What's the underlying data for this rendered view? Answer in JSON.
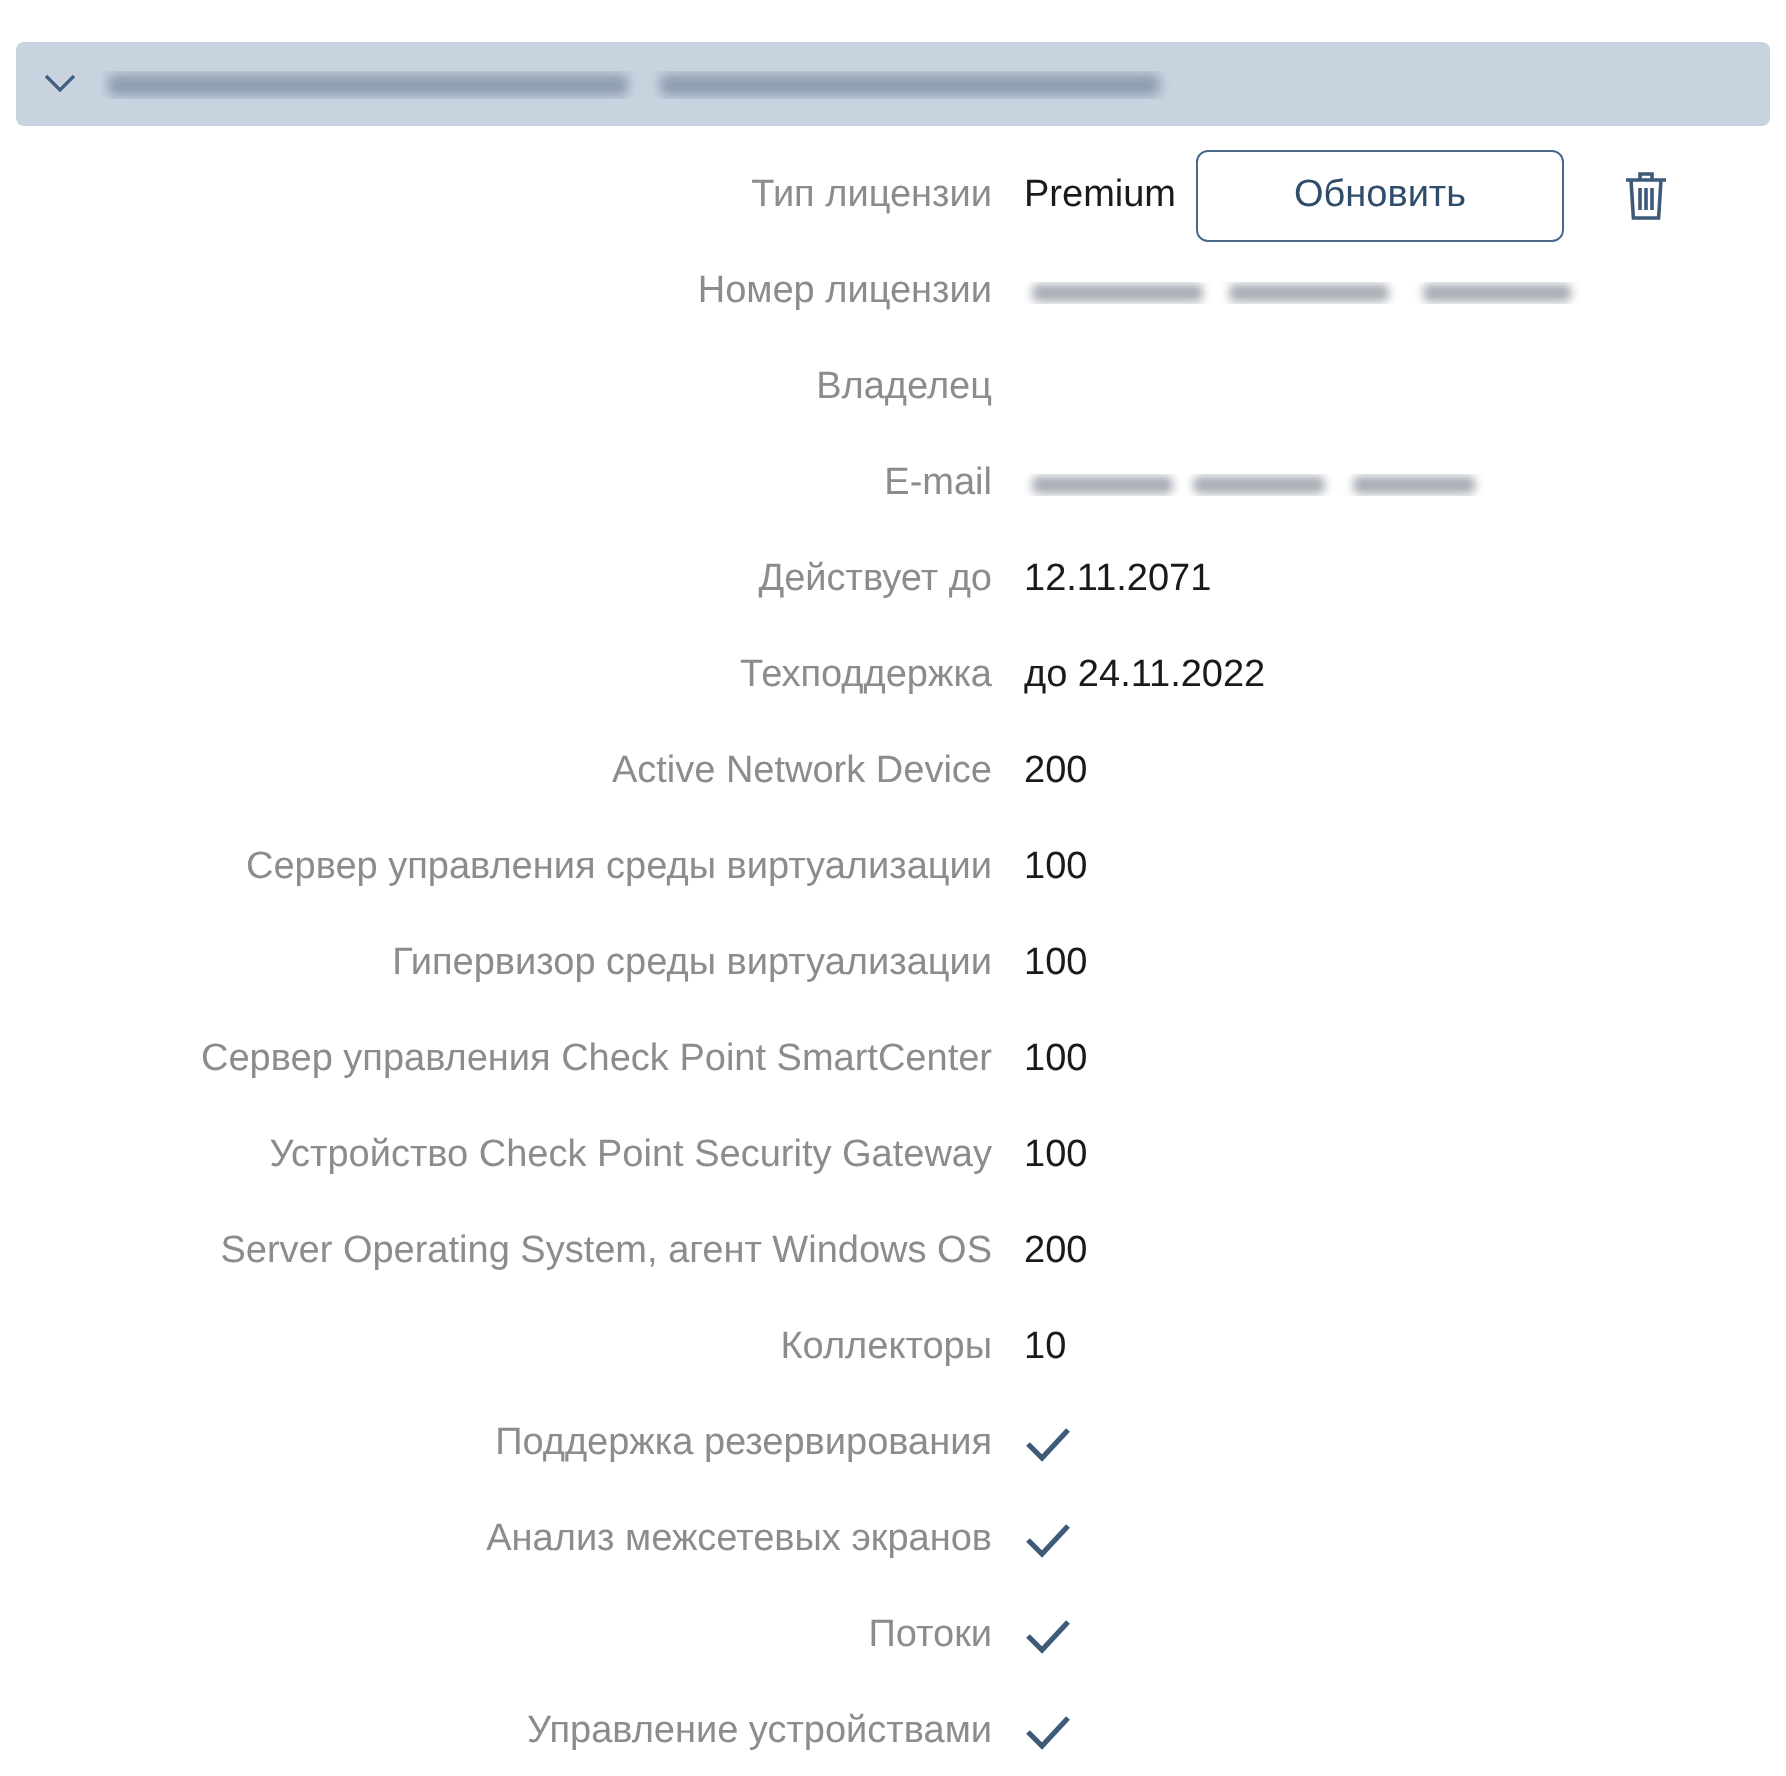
{
  "header": {
    "expanded": true,
    "title_redacted": true
  },
  "update_button": "Обновить",
  "rows": [
    {
      "label": "Тип лицензии",
      "kind": "text",
      "value": "Premium"
    },
    {
      "label": "Номер лицензии",
      "kind": "redacted"
    },
    {
      "label": "Владелец",
      "kind": "empty"
    },
    {
      "label": "E-mail",
      "kind": "redacted"
    },
    {
      "label": "Действует до",
      "kind": "text",
      "value": "12.11.2071"
    },
    {
      "label": "Техподдержка",
      "kind": "text",
      "value": "до 24.11.2022"
    },
    {
      "label": "Active Network Device",
      "kind": "text",
      "value": "200"
    },
    {
      "label": "Сервер управления среды виртуализации",
      "kind": "text",
      "value": "100"
    },
    {
      "label": "Гипервизор среды виртуализации",
      "kind": "text",
      "value": "100"
    },
    {
      "label": "Сервер управления Check Point SmartCenter",
      "kind": "text",
      "value": "100"
    },
    {
      "label": "Устройство Check Point Security Gateway",
      "kind": "text",
      "value": "100"
    },
    {
      "label": "Server Operating System, агент Windows OS",
      "kind": "text",
      "value": "200"
    },
    {
      "label": "Коллекторы",
      "kind": "text",
      "value": "10"
    },
    {
      "label": "Поддержка резервирования",
      "kind": "check",
      "checked": true
    },
    {
      "label": "Анализ межсетевых экранов",
      "kind": "check",
      "checked": true
    },
    {
      "label": "Потоки",
      "kind": "check",
      "checked": true
    },
    {
      "label": "Управление устройствами",
      "kind": "check",
      "checked": true
    }
  ]
}
